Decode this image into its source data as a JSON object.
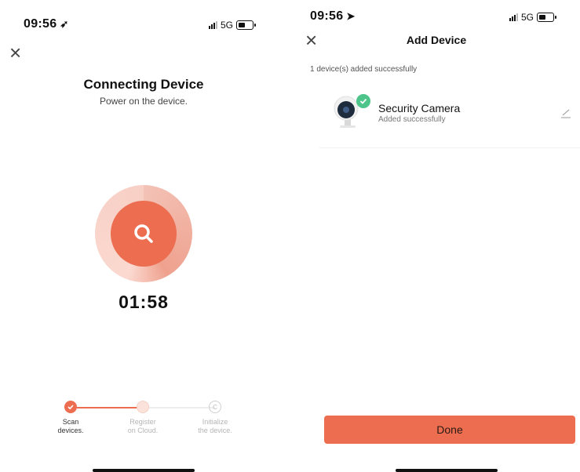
{
  "left": {
    "status": {
      "time": "09:56",
      "network": "5G"
    },
    "title": "Connecting Device",
    "subtitle": "Power on the device.",
    "timer": "01:58",
    "steps": [
      {
        "label_line1": "Scan",
        "label_line2": "devices.",
        "state": "done"
      },
      {
        "label_line1": "Register",
        "label_line2": "on Cloud.",
        "state": "pending"
      },
      {
        "label_line1": "Initialize",
        "label_line2": "the device.",
        "state": "pending"
      }
    ]
  },
  "right": {
    "status": {
      "time": "09:56",
      "network": "5G"
    },
    "title": "Add Device",
    "added_count_text": "1 device(s) added successfully",
    "device": {
      "name": "Security Camera",
      "status": "Added successfully"
    },
    "done_label": "Done"
  },
  "colors": {
    "accent": "#ec6d4f",
    "success": "#4cc48a"
  },
  "icons": [
    "location-arrow-icon",
    "signal-icon",
    "battery-icon",
    "close-icon",
    "search-icon",
    "check-icon",
    "camera-icon",
    "edit-icon"
  ]
}
